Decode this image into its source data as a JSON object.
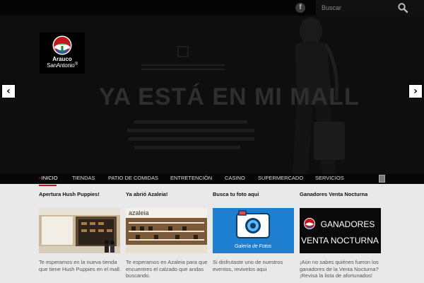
{
  "topbar": {
    "facebook_glyph": "f",
    "search_placeholder": "Buscar",
    "icons": [
      "facebook-icon",
      "search-icon"
    ]
  },
  "hero": {
    "logo_line1": "Arauco",
    "logo_line2": "SanAntonio",
    "logo_registered": "®",
    "title": "YA ESTÁ EN MI MALL",
    "prev_glyph": "‹",
    "next_glyph": "›"
  },
  "nav": {
    "items": [
      "INICIO",
      "TIENDAS",
      "PATIO DE COMIDAS",
      "ENTRETENCIÓN",
      "CASINO",
      "SUPERMERCADO",
      "SERVICIOS"
    ],
    "active_bullet": "•"
  },
  "cards": [
    {
      "title": "Apertura Hush Puppies!",
      "text": "Te esperamos en la nueva tienda que tiene Hush Puppies en el mall."
    },
    {
      "title": "Ya abrió Azaleia!",
      "text": "Te esperamos en Azaleia para que encuentres el calzado que andas buscando.",
      "image_label": "azaleia"
    },
    {
      "title": "Busca tu foto aqui",
      "text": "Si disfrutaste uno de nuestros eventos, revivelos aqui",
      "image_label": "Galería de Fotos"
    },
    {
      "title": "Ganadores Venta Nocturna",
      "text": "¡Aún no sabes quiénes fueron los ganadores de la Venta Nocturna? ¡Revisa la lista de afortunados!",
      "image_line1": "GANADORES",
      "image_line2": "VENTA NOCTURNA"
    }
  ],
  "colors": {
    "accent_red": "#c4161c",
    "accent_green": "#1e8a3a",
    "accent_blue": "#1f5fa8",
    "nav_bg": "#070707",
    "content_bg": "#e9e9e9"
  }
}
